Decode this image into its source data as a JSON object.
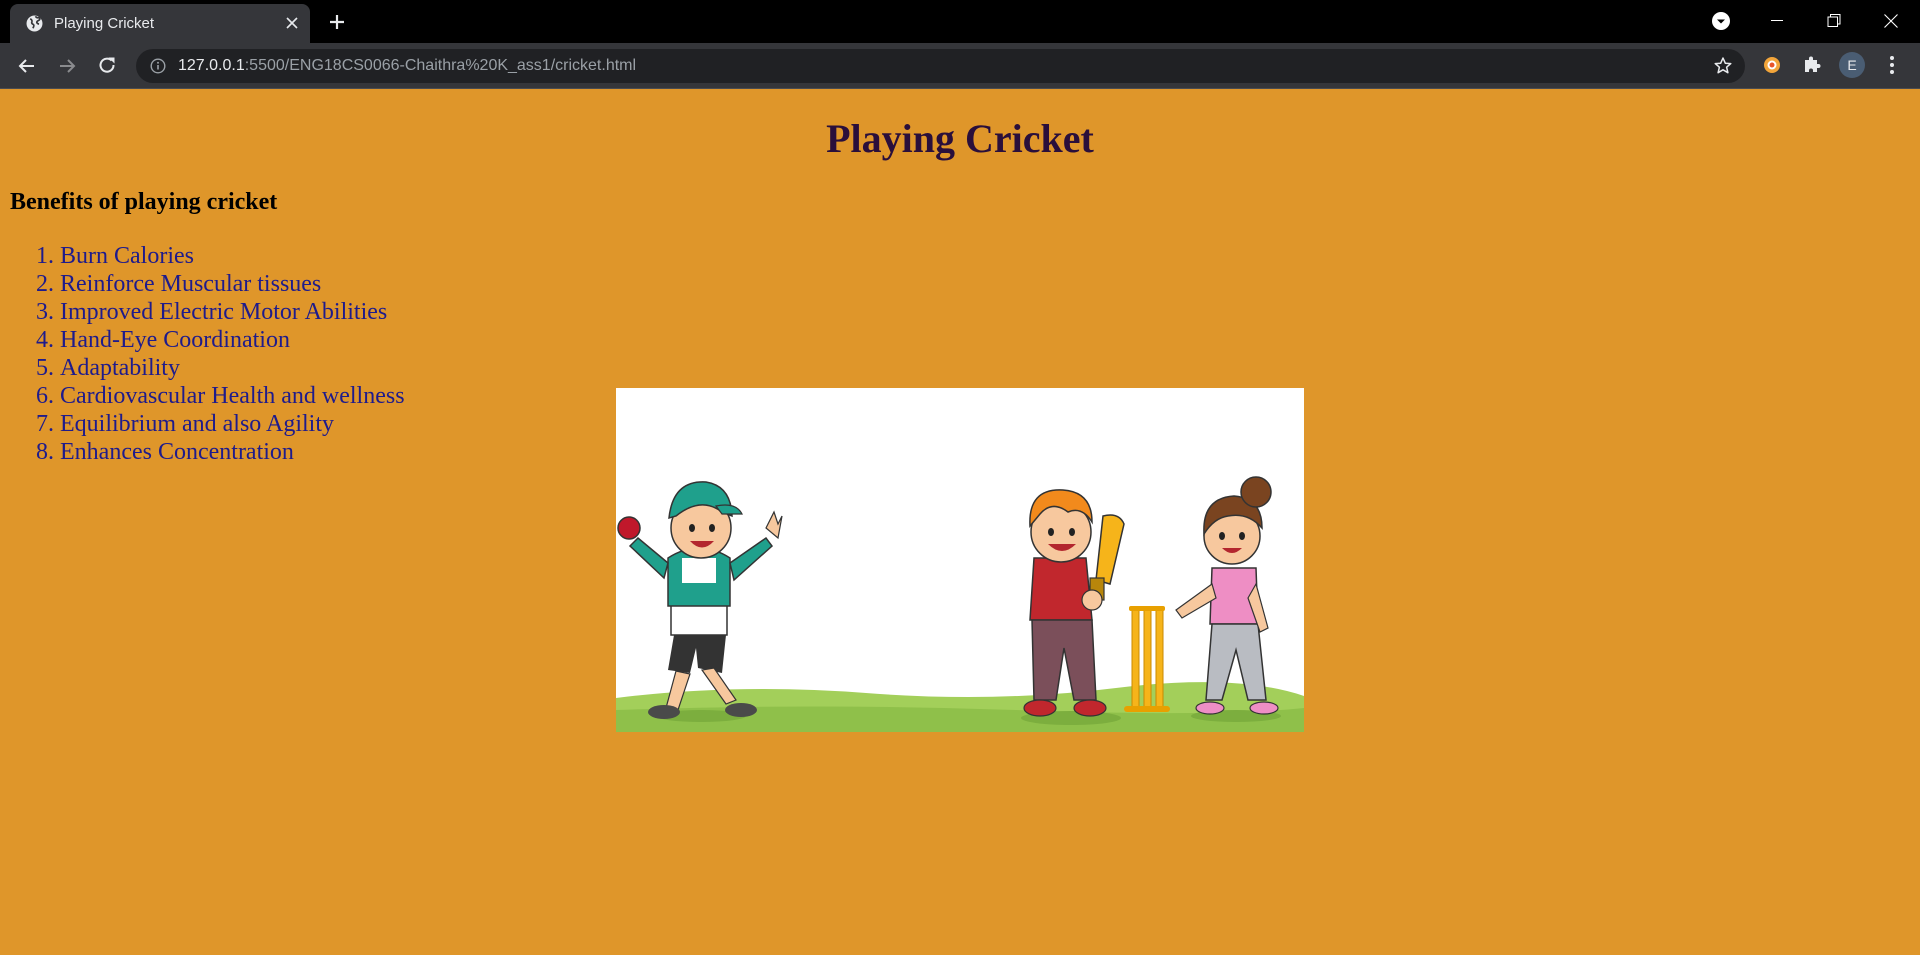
{
  "browser": {
    "tab": {
      "title": "Playing Cricket"
    },
    "address_bar": {
      "url_host": "127.0.0.1",
      "url_rest": ":5500/ENG18CS0066-Chaithra%20K_ass1/cricket.html"
    },
    "profile_initial": "E"
  },
  "page": {
    "title": "Playing Cricket",
    "subheading": "Benefits of playing cricket",
    "benefits": [
      "Burn Calories",
      "Reinforce Muscular tissues",
      "Improved Electric Motor Abilities",
      "Hand-Eye Coordination",
      "Adaptability",
      "Cardiovascular Health and wellness",
      "Equilibrium and also Agility",
      "Enhances Concentration"
    ]
  },
  "colors": {
    "page_background": "#df962a",
    "title_color": "#2a0f3b",
    "list_color": "#1e1b8c"
  }
}
